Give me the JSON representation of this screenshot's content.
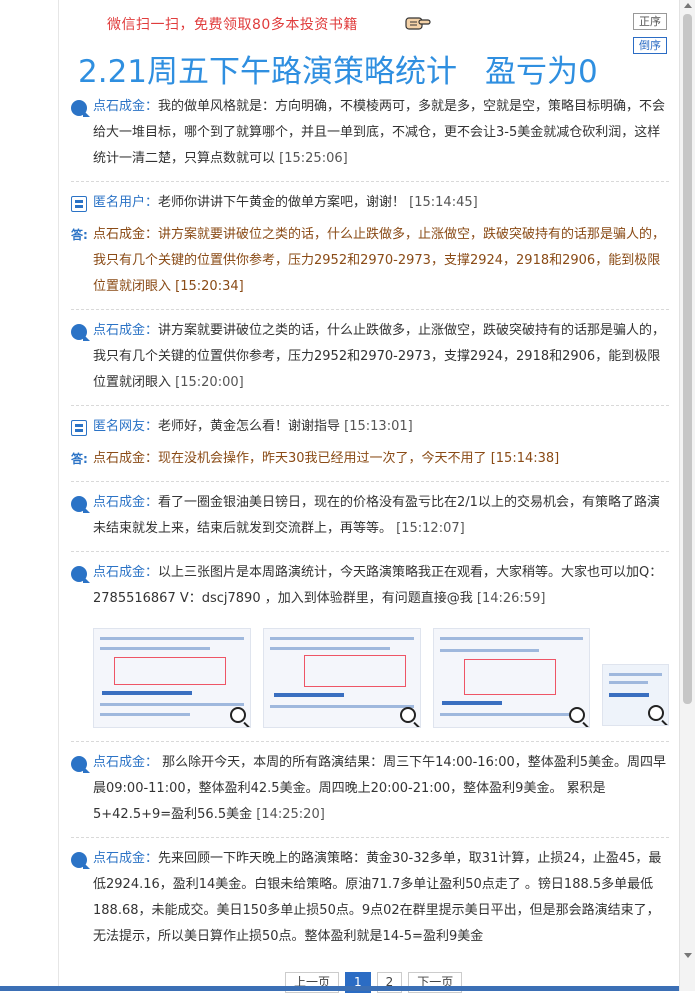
{
  "header": {
    "promo_text": "微信扫一扫，免费领取80多本投资书籍",
    "sort_asc_label": "正序",
    "sort_desc_label": "倒序",
    "title_main": "2.21周五下午路演策略统计",
    "title_result": "盈亏为0"
  },
  "feed": [
    {
      "who": "点石成金：",
      "text": "我的做单风格就是：方向明确，不模棱两可，多就是多，空就是空，策略目标明确，不会给大一堆目标，哪个到了就算哪个，并且一单到底，不减仓，更不会让3-5美金就减仓砍利润，这样统计一清二楚，只算点数就可以",
      "time": "[15:25:06]"
    },
    {
      "who": "匿名用户：",
      "text": "老师你讲讲下午黄金的做单方案吧，谢谢！",
      "time": "[15:14:45]",
      "answer_tag": "答:",
      "answer_who": "点石成金：",
      "answer_text": "讲方案就要讲破位之类的话，什么止跌做多，止涨做空，跌破突破持有的话那是骗人的，我只有几个关键的位置供你参考，压力2952和2970-2973，支撑2924，2918和2906，能到极限位置就闭眼入",
      "answer_time": "[15:20:34]"
    },
    {
      "who": "点石成金：",
      "text": "讲方案就要讲破位之类的话，什么止跌做多，止涨做空，跌破突破持有的话那是骗人的，我只有几个关键的位置供你参考，压力2952和2970-2973，支撑2924，2918和2906，能到极限位置就闭眼入",
      "time": "[15:20:00]"
    },
    {
      "who": "匿名网友：",
      "text": "老师好，黄金怎么看！谢谢指导",
      "time": "[15:13:01]",
      "answer_tag": "答:",
      "answer_who": "点石成金：",
      "answer_text": "现在没机会操作，昨天30我已经用过一次了，今天不用了",
      "answer_time": "[15:14:38]"
    },
    {
      "who": "点石成金：",
      "text": "看了一圈金银油美日镑日，现在的价格没有盈亏比在2/1以上的交易机会，有策略了路演未结束就发上来，结束后就发到交流群上，再等等。",
      "time": "[15:12:07]"
    },
    {
      "who": "点石成金：",
      "text": "以上三张图片是本周路演统计，今天路演策略我正在观看，大家稍等。大家也可以加Q：2785516867  V：dscj7890 ，加入到体验群里，有问题直接@我",
      "time": "[14:26:59]"
    },
    {
      "who": "点石成金：",
      "text": " 那么除开今天，本周的所有路演结果：周三下午14:00-16:00，整体盈利5美金。周四早晨09:00-11:00，整体盈利42.5美金。周四晚上20:00-21:00，整体盈利9美金。 累积是5+42.5+9=盈利56.5美金",
      "time": "[14:25:20]"
    },
    {
      "who": "点石成金：",
      "text": "先来回顾一下昨天晚上的路演策略：黄金30-32多单，取31计算，止损24，止盈45，最低2924.16，盈利14美金。白银未给策略。原油71.7多单让盈利50点走了 。镑日188.5多单最低188.68，未能成交。美日150多单止损50点。9点02在群里提示美日平出，但是那会路演结束了，无法提示，所以美日算作止损50点。整体盈利就是14-5=盈利9美金",
      "time": ""
    }
  ],
  "pager": {
    "prev": "上一页",
    "page1": "1",
    "page2": "2",
    "next": "下一页"
  }
}
